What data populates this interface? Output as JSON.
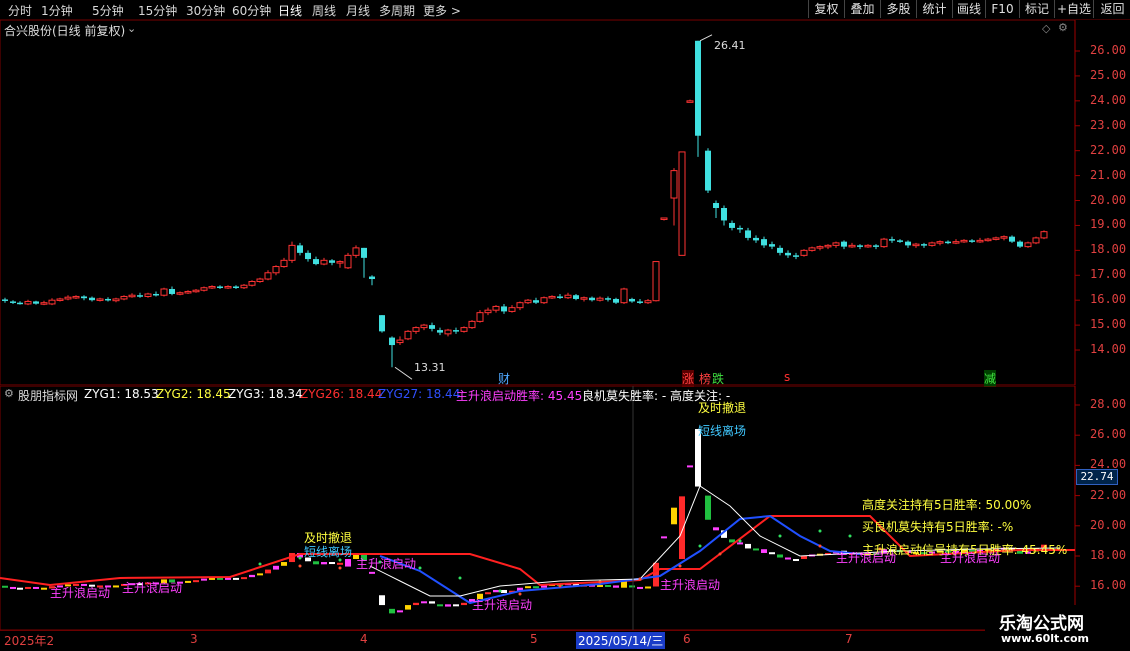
{
  "toolbar": {
    "periods": [
      "分时",
      "1分钟",
      "5分钟",
      "15分钟",
      "30分钟",
      "60分钟",
      "日线",
      "周线",
      "月线",
      "多周期",
      "更多"
    ],
    "active_period": "日线",
    "more_arrow": ">",
    "buttons": [
      "复权",
      "叠加",
      "多股",
      "统计",
      "画线",
      "F10",
      "标记",
      "+自选",
      "返回"
    ]
  },
  "main_chart": {
    "title": "合兴股份(日线 前复权)",
    "high_label": "26.41",
    "low_label": "13.31",
    "y_ticks": [
      "26.00",
      "25.00",
      "24.00",
      "23.00",
      "22.00",
      "21.00",
      "20.00",
      "19.00",
      "18.00",
      "17.00",
      "16.00",
      "15.00",
      "14.00"
    ],
    "event_markers": [
      {
        "text": "财",
        "color": "#4fa8ff"
      },
      {
        "text": "涨",
        "color": "#ff4040",
        "bg": "#5a0000"
      },
      {
        "text": "榜",
        "color": "#ff4040"
      },
      {
        "text": "跌",
        "color": "#40e040"
      },
      {
        "text": "s",
        "color": "#ff3030"
      },
      {
        "text": "减",
        "color": "#40e040",
        "bg": "#004000"
      }
    ]
  },
  "sub_chart": {
    "name": "股朋指标网",
    "legend": [
      {
        "text": "ZYG1: 18.53",
        "color": "#ffffff"
      },
      {
        "text": "ZYG2: 18.45",
        "color": "#ffff40"
      },
      {
        "text": "ZYG3: 18.34",
        "color": "#ffffff"
      },
      {
        "text": "ZYG26: 18.44",
        "color": "#ff3030"
      },
      {
        "text": "ZYG27: 18.44",
        "color": "#3050ff"
      },
      {
        "text": "主升浪启动胜率: 45.45",
        "color": "#ff40ff"
      },
      {
        "text": "良机莫失胜率: -",
        "color": "#ffffff"
      },
      {
        "text": "高度关注: -",
        "color": "#ffffff"
      }
    ],
    "current_value": "22.74",
    "y_ticks": [
      "28.00",
      "26.00",
      "24.00",
      "22.00",
      "20.00",
      "18.00",
      "16.00"
    ],
    "stats": [
      "高度关注持有5日胜率: 50.00%",
      "买良机莫失持有5日胜率: -%",
      "主升浪启动信号持有5日胜率: 45.45%"
    ],
    "annotations": {
      "retreat": "及时撤退",
      "short_exit": "短线离场",
      "main_rise": "主升浪启动"
    }
  },
  "time_axis": {
    "labels": [
      "2025年2",
      "3",
      "4",
      "5",
      "6",
      "7"
    ],
    "cursor_date": "2025/05/14/三"
  },
  "watermark": {
    "line1": "乐淘公式网",
    "line2": "www.60lt.com"
  }
}
